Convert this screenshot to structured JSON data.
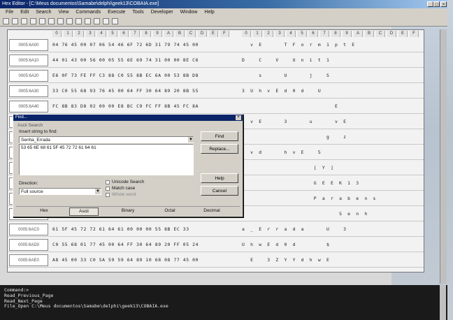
{
  "window": {
    "title": "Hex Editor - [C:\\Meus documentos\\Samabe\\delphi\\geek13\\COBAIA.exe]",
    "controls": [
      "_",
      "□",
      "×"
    ]
  },
  "menu": [
    "File",
    "Edit",
    "Search",
    "View",
    "Commands",
    "Execute",
    "Tools",
    "Developer",
    "Window",
    "Help"
  ],
  "toolbar_icons": [
    "new-icon",
    "open-icon",
    "save-icon",
    "save-all-icon",
    "print-icon",
    "preview-icon",
    "copy-icon",
    "paste-icon",
    "find-icon",
    "find-next-icon",
    "replace-icon",
    "goto-icon",
    "bookmark-icon"
  ],
  "columns_hex": [
    "0",
    "1",
    "2",
    "3",
    "4",
    "5",
    "6",
    "7",
    "8",
    "9",
    "A",
    "B",
    "C",
    "D",
    "E",
    "F"
  ],
  "columns_ascii": [
    "0",
    "1",
    "2",
    "3",
    "4",
    "5",
    "6",
    "7",
    "8",
    "9",
    "A",
    "B",
    "C",
    "D",
    "E",
    "F"
  ],
  "rows": [
    {
      "addr": "0005:6A00",
      "hex": "04 76 45 00 07 06 54 46 6F 72 6D 31 79 74 45 00",
      "ascii": "  v E     T F o r m 1 p t E  "
    },
    {
      "addr": "0005:6A10",
      "hex": "44 01 43 00 56 00 05 55 6E 69 74 31 00 00 8E C6",
      "ascii": "D   C   V   U n i t 1        "
    },
    {
      "addr": "0005:6A20",
      "hex": "E6 0F 73 FE FF C3 88 C0 55 8B EC 6A 00 53 8B D8",
      "ascii": "    s     U     j   S        "
    },
    {
      "addr": "0005:6A30",
      "hex": "33 C0 55 68 93 76 45 00 64 FF 30 64 89 20 8B 55",
      "ascii": "3 U h v E d 0 d   U          "
    },
    {
      "addr": "0005:6A40",
      "hex": "FC 8B 83 D8 02 00 00 E8 BC C9 FC FF 8B 45 FC 8A",
      "ascii": "                      E      "
    },
    {
      "addr": "0005:6A50",
      "hex": "",
      "ascii": "  v E     3     u     v E    "
    },
    {
      "addr": "0005:6A60",
      "hex": "",
      "ascii": "                    g   z    "
    },
    {
      "addr": "0005:6A70",
      "hex": "",
      "ascii": "  v d     h v E   5          "
    },
    {
      "addr": "0005:6A80",
      "hex": "",
      "ascii": "                 [ Y ]       "
    },
    {
      "addr": "0005:6A90",
      "hex": "",
      "ascii": "                 G E E K 1 3 "
    },
    {
      "addr": "0005:6AA0",
      "hex": "",
      "ascii": "                 P a r a b e n s"
    },
    {
      "addr": "0005:6AB0",
      "hex": "",
      "ascii": "                       S e n h"
    },
    {
      "addr": "0005:6AC0",
      "hex": "61 5F 45 72 72 61 64 61 00 00 00 55 8B EC 33",
      "ascii": "a _ E r r a d a     U   3    "
    },
    {
      "addr": "0005:6AD0",
      "hex": "C0 55 68 01 77 45 00 64 FF 30 64 89 20 FF 05 24",
      "ascii": "U h w E d 0 d       $        "
    },
    {
      "addr": "0005:6AE0",
      "hex": "A8 45 00 33 C0 5A 59 59 64 89 10 68 08 77 45 00",
      "ascii": "  E   3 Z Y Y d h w E        "
    }
  ],
  "find_dialog": {
    "title": "Find...",
    "group_label": "Ascii Search",
    "prompt": "Insert string to find:",
    "search_value": "Senha_Errada",
    "hex_preview": "53 65 6E 68 61 5F 45 72 72 61 64 61",
    "direction_label": "Direction:",
    "direction_value": "Full source",
    "option_unicode": "Unicode Search",
    "option_match_case": "Match case",
    "option_whole": "Whole word",
    "buttons": {
      "find": "Find",
      "replace": "Replace...",
      "help": "Help",
      "cancel": "Cancel"
    },
    "tabs": [
      "Hex",
      "Ascii",
      "Binary",
      "Octal",
      "Decimal"
    ],
    "active_tab": "Ascii"
  },
  "command_pane": {
    "lines": [
      "Command:>",
      "Read_Previous_Page",
      "Read_Next_Page",
      "File_Open C:\\Meus documentos\\Samabe\\delphi\\geek13\\COBAIA.exe"
    ]
  }
}
